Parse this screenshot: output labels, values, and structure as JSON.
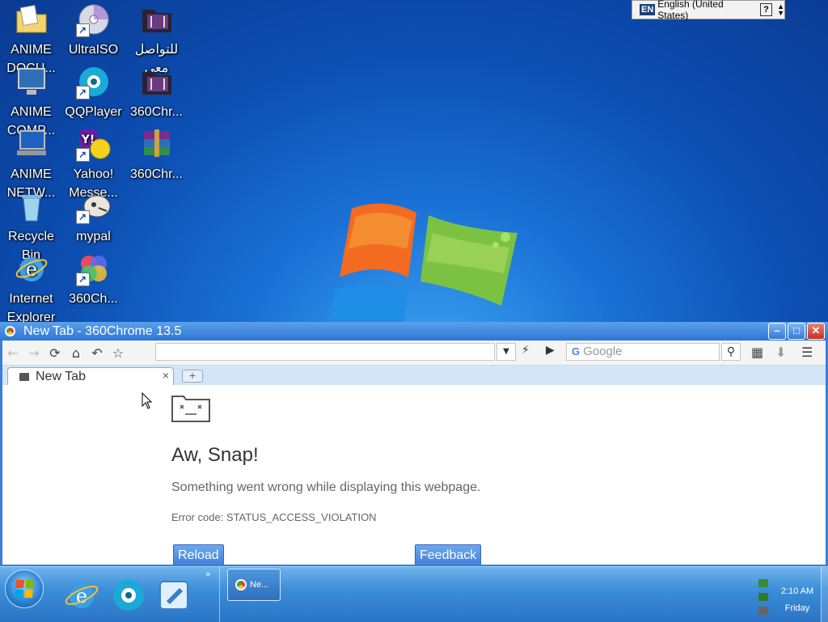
{
  "language_bar": {
    "code": "EN",
    "language": "English (United States)",
    "help": "?"
  },
  "desktop_icons": [
    {
      "label": "ANIME DOCU..."
    },
    {
      "label": "UltraISO"
    },
    {
      "label": "للتواصل معي"
    },
    {
      "label": "ANIME COMP..."
    },
    {
      "label": "QQPlayer"
    },
    {
      "label": "360Chr..."
    },
    {
      "label": "ANIME NETW..."
    },
    {
      "label": "Yahoo! Messe..."
    },
    {
      "label": "360Chr..."
    },
    {
      "label": "Recycle Bin"
    },
    {
      "label": "mypal"
    },
    {
      "label": "Internet Explorer"
    },
    {
      "label": "360Ch..."
    }
  ],
  "browser": {
    "title": "New Tab - 360Chrome 13.5",
    "address_value": "",
    "search_placeholder": "Google",
    "tab_label": "New Tab",
    "tab_close": "×",
    "new_tab_symbol": "+",
    "error": {
      "heading": "Aw, Snap!",
      "message": "Something went wrong while displaying this webpage.",
      "code": "Error code: STATUS_ACCESS_VIOLATION",
      "reload": "Reload",
      "feedback": "Feedback"
    }
  },
  "taskbar": {
    "task_label": "Ne...",
    "time": "2:10 AM",
    "day": "Friday",
    "chevron": "»"
  }
}
